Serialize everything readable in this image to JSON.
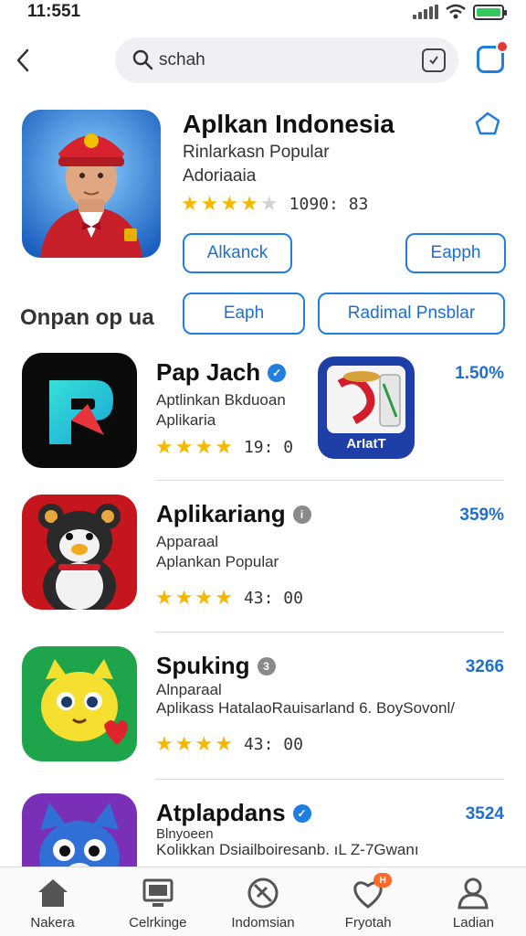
{
  "status": {
    "time": "11:551"
  },
  "search": {
    "query": "schah"
  },
  "featured": {
    "title": "Aplkan Indonesia",
    "subtitle1": "Rinlarkasn Popular",
    "subtitle2": "Adoriaaia",
    "stars": 4,
    "rating_text": "1090: 83",
    "button_left": "Alkanck",
    "button_right": "Eapph"
  },
  "section": {
    "title": "Onpan op ua",
    "button1": "Eaph",
    "button2": "Radimal Pnsblar"
  },
  "apps": [
    {
      "name": "Pap Jach",
      "badge": "blue",
      "line1": "Aptlinkan Bkduoan",
      "line2": "Aplikaria",
      "stars": 4,
      "rating": "19: 0",
      "pct": "1.50%",
      "icon": "p-logo-icon",
      "side_label": "ArIatT"
    },
    {
      "name": "Aplikariang",
      "badge": "grey",
      "line1": "Apparaal",
      "line2": "Aplankan Popular",
      "stars": 4,
      "rating": "43: 00",
      "pct": "359%",
      "icon": "penguin-bear-icon"
    },
    {
      "name": "Spuking",
      "badge": "grey",
      "line1": "Alnparaal",
      "line2": "Aplikass HatalaoRauisarland 6. BoySovonl/",
      "stars": 4,
      "rating": "43: 00",
      "pct": "3266",
      "icon": "yellow-cat-icon"
    },
    {
      "name": "Atplapdans",
      "badge": "blue",
      "line1": "Blnyoeen",
      "line2": "Kolikkan Dsiailboiresanb. ıL Z-7Gwanı",
      "pct": "3524",
      "icon": "blue-cat-icon"
    }
  ],
  "nav": [
    {
      "label": "Nakera",
      "icon": "home-icon"
    },
    {
      "label": "Celrkinge",
      "icon": "tv-icon"
    },
    {
      "label": "Indomsian",
      "icon": "compass-icon"
    },
    {
      "label": "Fryotah",
      "icon": "heart-icon",
      "badge": "H"
    },
    {
      "label": "Ladian",
      "icon": "profile-icon"
    }
  ],
  "colors": {
    "accent": "#1f7fe0",
    "star": "#f5b800",
    "notification": "#e53935"
  }
}
